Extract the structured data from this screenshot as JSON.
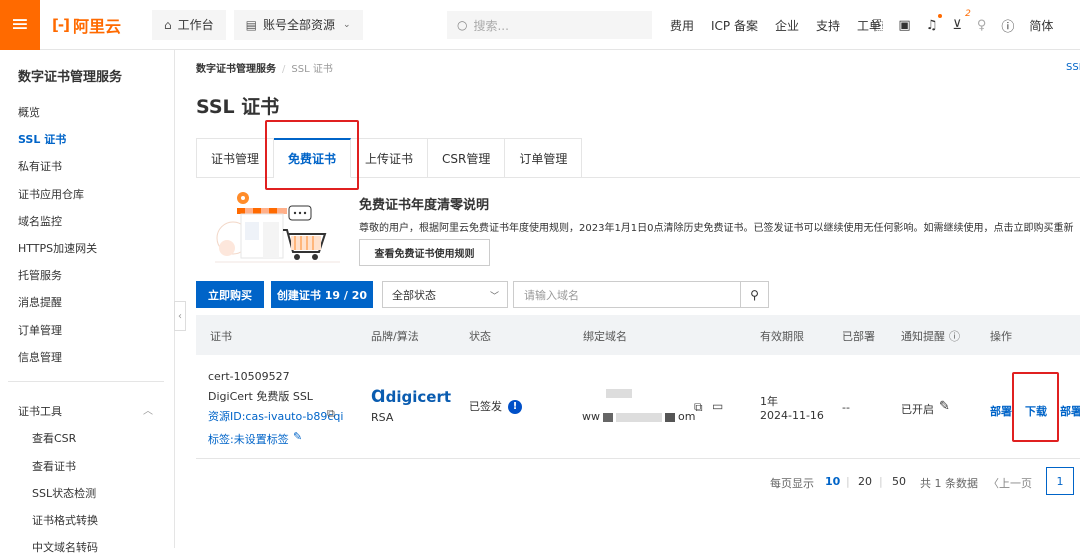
{
  "topbar": {
    "logo_text": "阿里云",
    "logo_mark": "[-]",
    "workbench": "工作台",
    "resources": "账号全部资源",
    "search_placeholder": "搜索...",
    "links": [
      "费用",
      "ICP 备案",
      "企业",
      "支持",
      "工单"
    ],
    "cart_count": "2",
    "lang": "简体"
  },
  "sidebar": {
    "title": "数字证书管理服务",
    "items": [
      "概览",
      "SSL 证书",
      "私有证书",
      "证书应用仓库",
      "域名监控",
      "HTTPS加速网关",
      "托管服务",
      "消息提醒",
      "订单管理",
      "信息管理"
    ],
    "tools_title": "证书工具",
    "tools": [
      "查看CSR",
      "查看证书",
      "SSL状态检测",
      "证书格式转换",
      "中文域名转码"
    ]
  },
  "breadcrumb": {
    "root": "数字证书管理服务",
    "current": "SSL 证书",
    "right_link": "SSL"
  },
  "page_title": "SSL 证书",
  "tabs": [
    "证书管理",
    "免费证书",
    "上传证书",
    "CSR管理",
    "订单管理"
  ],
  "notice": {
    "title": "免费证书年度清零说明",
    "text": "尊敬的用户，根据阿里云免费证书年度使用规则，2023年1月1日0点清除历史免费证书。已签发证书可以继续使用无任何影响。如需继续使用，点击立即购买重新",
    "button": "查看免费证书使用规则"
  },
  "toolbar": {
    "buy": "立即购买",
    "create": "创建证书 19 / 20",
    "status_select": "全部状态",
    "domain_placeholder": "请输入域名"
  },
  "table": {
    "headers": [
      "证书",
      "品牌/算法",
      "状态",
      "绑定域名",
      "有效期限",
      "已部署",
      "通知提醒",
      "操作"
    ],
    "row": {
      "cert_id": "cert-10509527",
      "cert_name": "DigiCert 免费版 SSL",
      "resource_id": "资源ID:cas-ivauto-b89cqi",
      "tag": "标签:未设置标签",
      "brand": "digicert",
      "algo": "RSA",
      "status": "已签发",
      "domain_prefix": "ww",
      "domain_suffix": "om",
      "validity": "1年",
      "expire": "2024-11-16",
      "deployed": "--",
      "notify": "已开启",
      "actions": [
        "部署",
        "下载",
        "部署"
      ]
    }
  },
  "pager": {
    "per_page_label": "每页显示",
    "sizes": [
      "10",
      "20",
      "50"
    ],
    "total": "共 1 条数据",
    "prev": "〈上一页",
    "current_page": "1"
  },
  "colors": {
    "brand_orange": "#ff6a00",
    "primary_blue": "#0064c8",
    "highlight_red": "#e02020"
  }
}
